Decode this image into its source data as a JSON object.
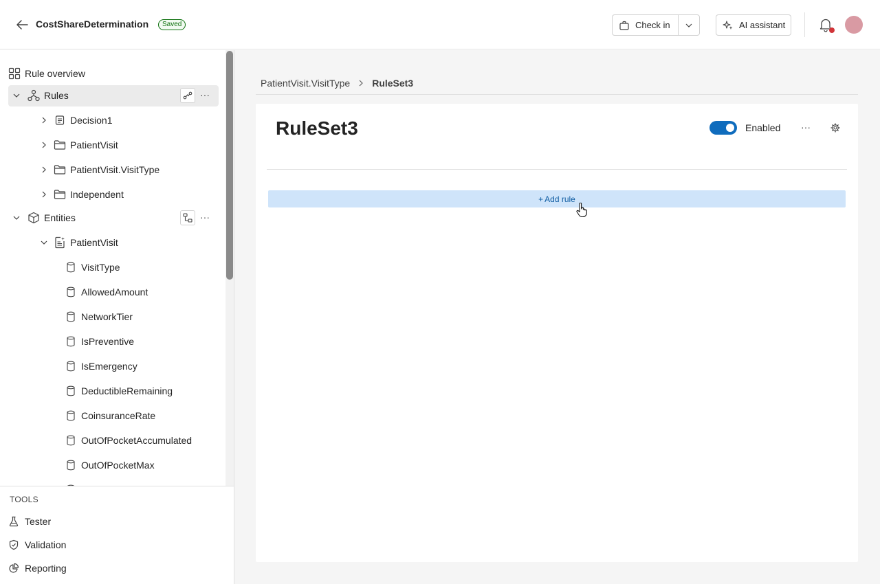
{
  "header": {
    "title": "CostShareDetermination",
    "status_badge": "Saved",
    "checkin_label": "Check in",
    "ai_label": "AI assistant"
  },
  "sidebar": {
    "overview_label": "Rule overview",
    "rules_label": "Rules",
    "rules_children": [
      {
        "label": "Decision1",
        "icon": "decision-icon"
      },
      {
        "label": "PatientVisit",
        "icon": "folder-icon"
      },
      {
        "label": "PatientVisit.VisitType",
        "icon": "folder-icon"
      },
      {
        "label": "Independent",
        "icon": "folder-icon"
      }
    ],
    "entities_label": "Entities",
    "entity_label": "PatientVisit",
    "fields": [
      "VisitType",
      "AllowedAmount",
      "NetworkTier",
      "IsPreventive",
      "IsEmergency",
      "DeductibleRemaining",
      "CoinsuranceRate",
      "OutOfPocketAccumulated",
      "OutOfPocketMax"
    ],
    "tools_title": "TOOLS",
    "tools": [
      {
        "label": "Tester",
        "icon": "flask-icon"
      },
      {
        "label": "Validation",
        "icon": "shield-check-icon"
      },
      {
        "label": "Reporting",
        "icon": "pie-chart-icon"
      }
    ]
  },
  "main": {
    "breadcrumb": [
      "PatientVisit.VisitType",
      "RuleSet3"
    ],
    "title": "RuleSet3",
    "enabled_label": "Enabled",
    "enabled": true,
    "add_rule_label": "Add rule"
  },
  "colors": {
    "accent": "#0f6cbd",
    "add_rule_bg": "#cfe4fa",
    "saved_green": "#0e700e",
    "notification_dot": "#d13438",
    "avatar": "#d99aa3"
  }
}
